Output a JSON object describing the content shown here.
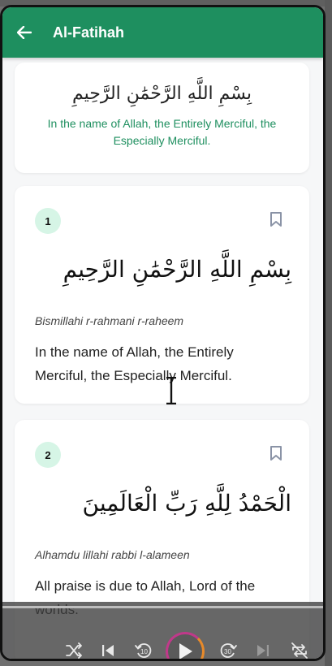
{
  "app_bar": {
    "title": "Al-Fatihah"
  },
  "intro": {
    "arabic": "بِسْمِ اللَّهِ الرَّحْمَٰنِ الرَّحِيمِ",
    "translation": "In the name of Allah, the Entirely Merciful, the Especially Merciful."
  },
  "verses": [
    {
      "number": "1",
      "arabic": "بِسْمِ اللَّهِ الرَّحْمَٰنِ الرَّحِيمِ",
      "transliteration": "Bismillahi r-rahmani r-raheem",
      "translation": "In the name of Allah, the Entirely Merciful, the Especially Merciful."
    },
    {
      "number": "2",
      "arabic": "الْحَمْدُ لِلَّهِ رَبِّ الْعَالَمِينَ",
      "transliteration": "Alhamdu lillahi rabbi l-alameen",
      "translation": "All praise is due to Allah, Lord of the worlds."
    }
  ],
  "player": {
    "icons": [
      "shuffle-icon",
      "skip-previous-icon",
      "replay-10-icon",
      "play-icon",
      "forward-30-icon",
      "skip-next-icon",
      "repeat-off-icon"
    ],
    "replay_seconds": "10",
    "forward_seconds": "30"
  },
  "colors": {
    "primary": "#1e8f5f",
    "badge_bg": "#d6f5e6",
    "background": "#f6f7f8"
  }
}
